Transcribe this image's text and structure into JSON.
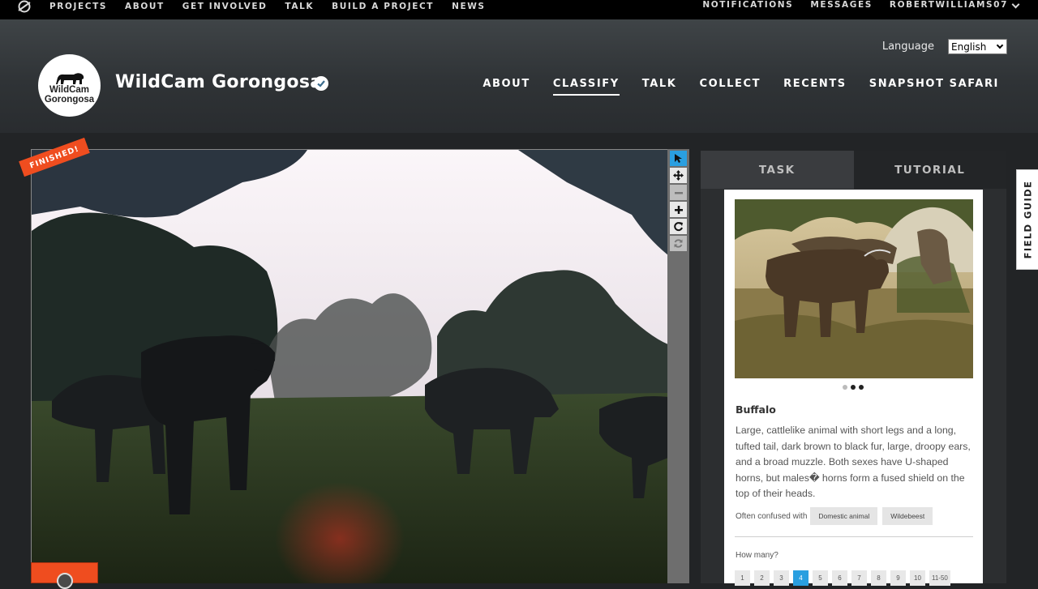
{
  "topbar": {
    "logo_icon": "zooniverse-icon",
    "nav": [
      "PROJECTS",
      "ABOUT",
      "GET INVOLVED",
      "TALK",
      "BUILD A PROJECT",
      "NEWS"
    ],
    "notifications": "NOTIFICATIONS",
    "messages": "MESSAGES",
    "username": "ROBERTWILLIAMS07"
  },
  "header": {
    "language_label": "Language",
    "language_value": "English",
    "avatar_line1": "WildCam",
    "avatar_line2": "Gorongosa",
    "title": "WildCam Gorongosa",
    "nav": [
      {
        "label": "ABOUT",
        "active": false
      },
      {
        "label": "CLASSIFY",
        "active": true
      },
      {
        "label": "TALK",
        "active": false
      },
      {
        "label": "COLLECT",
        "active": false
      },
      {
        "label": "RECENTS",
        "active": false
      },
      {
        "label": "SNAPSHOT SAFARI",
        "active": false
      }
    ]
  },
  "viewer": {
    "finished_badge": "FINISHED!",
    "tools": [
      "pointer-icon",
      "move-icon",
      "zoom-out-icon",
      "zoom-in-icon",
      "rotate-icon",
      "reset-icon"
    ]
  },
  "panel": {
    "tabs": [
      "TASK",
      "TUTORIAL"
    ],
    "carousel_total": 3,
    "carousel_active": 2,
    "animal_name": "Buffalo",
    "description": "Large, cattlelike animal with short legs and a long, tufted tail, dark brown to black fur, large, droopy ears, and a broad muzzle. Both sexes have U-shaped horns, but males� horns form a fused shield on the top of their heads.",
    "confused_label": "Often confused with",
    "confused_with": [
      "Domestic animal",
      "Wildebeest"
    ],
    "how_many_label": "How many?",
    "counts": [
      "1",
      "2",
      "3",
      "4",
      "5",
      "6",
      "7",
      "8",
      "9",
      "10",
      "11-50"
    ],
    "count_selected": "4"
  },
  "field_guide_label": "FIELD GUIDE",
  "colors": {
    "accent_orange": "#ef4d1f",
    "accent_blue": "#2a9fe0",
    "topbar_bg": "#000000",
    "panel_bg": "#2c2e30"
  }
}
